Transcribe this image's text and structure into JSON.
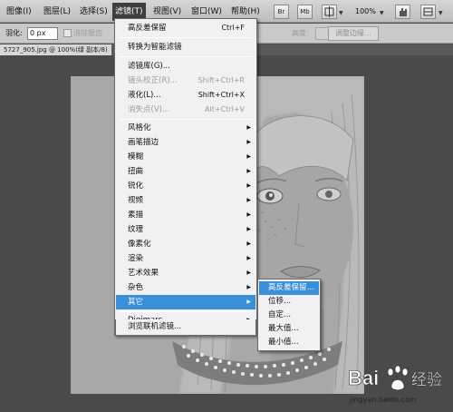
{
  "menubar": {
    "items": [
      {
        "label": "图像(I)"
      },
      {
        "label": "图层(L)"
      },
      {
        "label": "选择(S)"
      },
      {
        "label": "滤镜(T)"
      },
      {
        "label": "视图(V)"
      },
      {
        "label": "窗口(W)"
      },
      {
        "label": "帮助(H)"
      }
    ],
    "tool_buttons": [
      {
        "label": "Br"
      },
      {
        "label": "Mb"
      }
    ],
    "zoom": "100%"
  },
  "options": {
    "feather_label": "羽化:",
    "feather_value": "0 px",
    "antialias_label": "消除锯齿",
    "height_label": "高度:",
    "refine_edge": "调整边缘..."
  },
  "document": {
    "tab_title": "5727_905.jpg @ 100%(绿 副本/8)"
  },
  "filter_menu": {
    "items": [
      {
        "label": "高反差保留",
        "shortcut": "Ctrl+F",
        "disabled": false
      },
      {
        "separator": true
      },
      {
        "label": "转换为智能滤镜",
        "disabled": false
      },
      {
        "separator": true
      },
      {
        "label": "滤镜库(G)...",
        "disabled": false
      },
      {
        "label": "镜头校正(R)...",
        "shortcut": "Shift+Ctrl+R",
        "disabled": true
      },
      {
        "label": "液化(L)...",
        "shortcut": "Shift+Ctrl+X",
        "disabled": false
      },
      {
        "label": "消失点(V)...",
        "shortcut": "Alt+Ctrl+V",
        "disabled": true
      },
      {
        "separator": true
      },
      {
        "label": "风格化",
        "submenu": true
      },
      {
        "label": "画笔描边",
        "submenu": true
      },
      {
        "label": "模糊",
        "submenu": true
      },
      {
        "label": "扭曲",
        "submenu": true
      },
      {
        "label": "锐化",
        "submenu": true
      },
      {
        "label": "视频",
        "submenu": true
      },
      {
        "label": "素描",
        "submenu": true
      },
      {
        "label": "纹理",
        "submenu": true
      },
      {
        "label": "像素化",
        "submenu": true
      },
      {
        "label": "渲染",
        "submenu": true
      },
      {
        "label": "艺术效果",
        "submenu": true
      },
      {
        "label": "杂色",
        "submenu": true
      },
      {
        "label": "其它",
        "submenu": true,
        "selected": true
      },
      {
        "separator": true
      },
      {
        "label": "Digimarc",
        "submenu": true
      },
      {
        "separator": true
      },
      {
        "label": "浏览联机滤镜...",
        "disabled": false
      }
    ]
  },
  "submenu": {
    "items": [
      {
        "label": "高反差保留...",
        "selected": true
      },
      {
        "label": "位移..."
      },
      {
        "label": "自定..."
      },
      {
        "label": "最大值..."
      },
      {
        "label": "最小值..."
      }
    ]
  },
  "watermark": {
    "brand": "Bai",
    "brand_cn": "经验",
    "url": "jingyan.baidu.com"
  },
  "colors": {
    "menu_highlight": "#3a8fd9",
    "menubar_bg": "#c4c4c4",
    "canvas_bg": "#4a4a4a",
    "active_menu": "#3d3d3d"
  }
}
